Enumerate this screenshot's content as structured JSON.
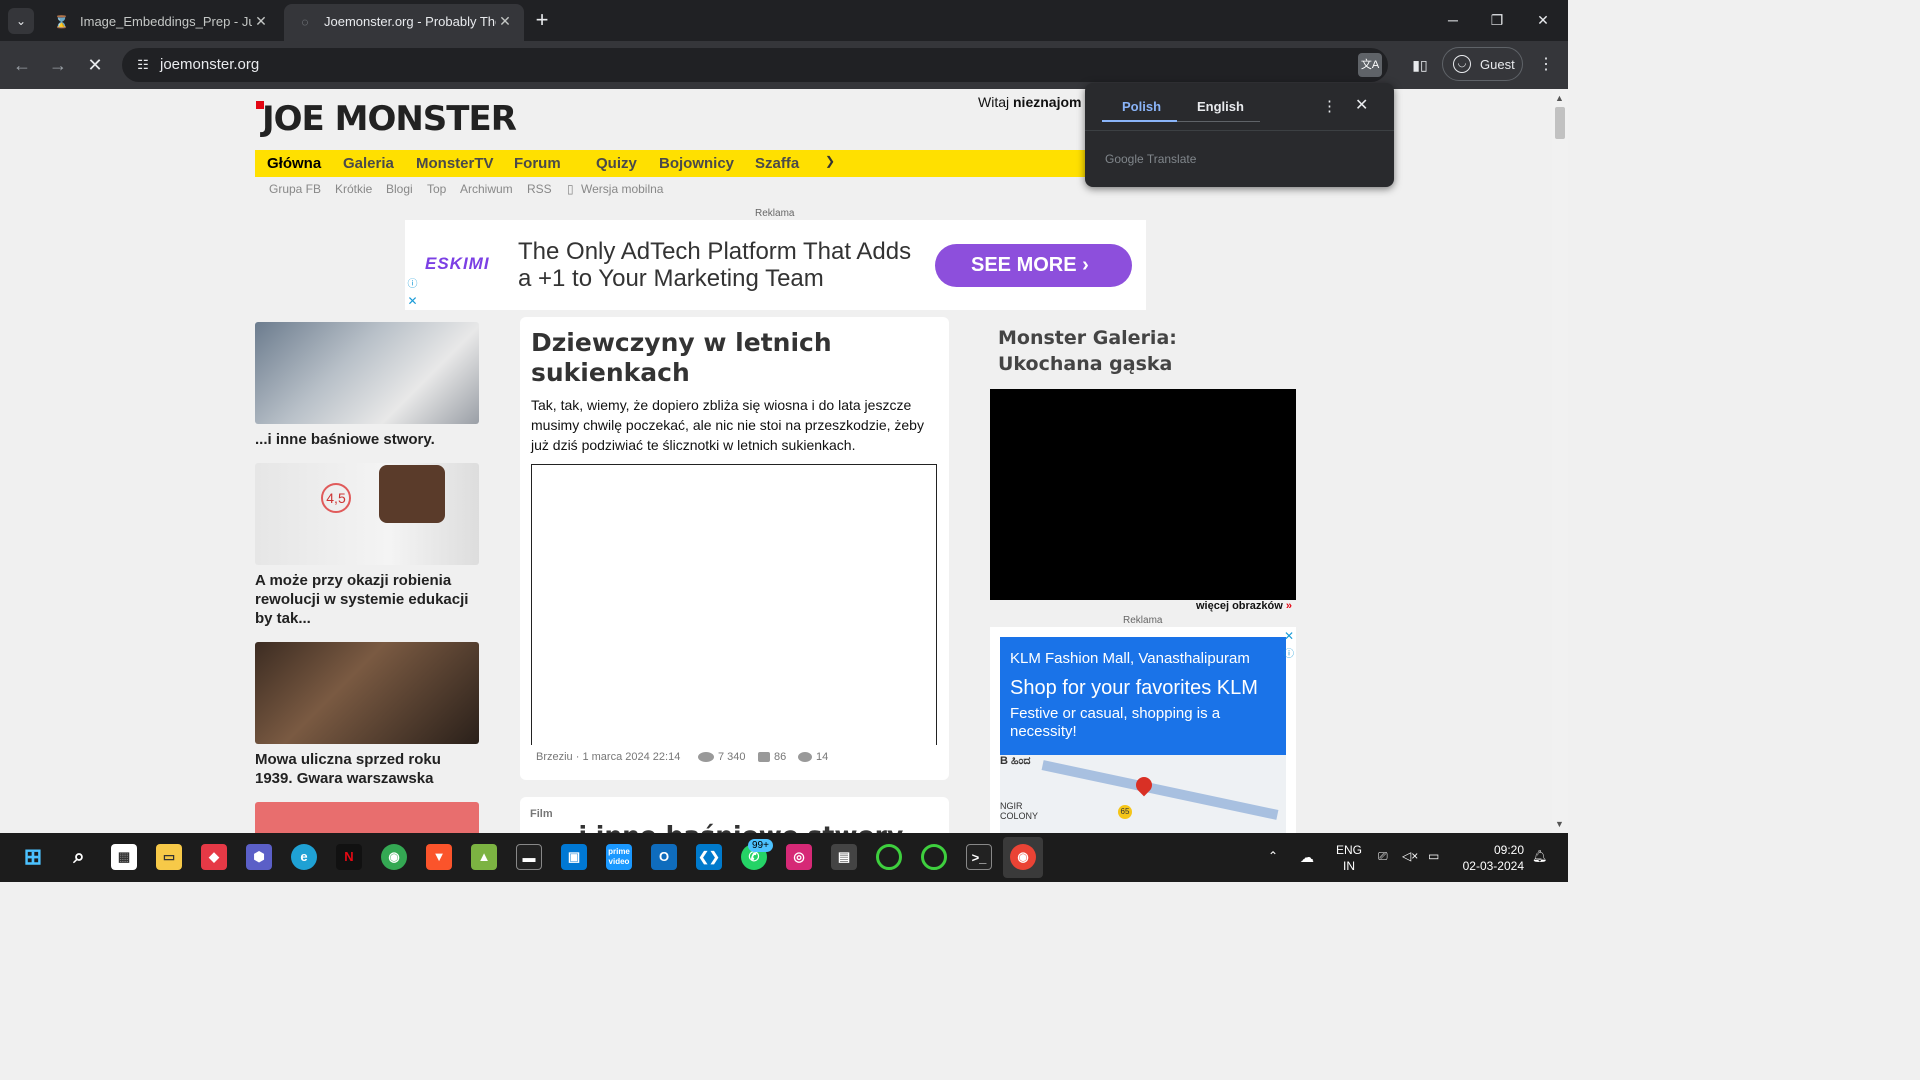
{
  "browser": {
    "tabs": [
      {
        "title": "Image_Embeddings_Prep - Jupy",
        "icon": "hourglass-icon"
      },
      {
        "title": "Joemonster.org - Probably The",
        "icon": "loading-icon"
      }
    ],
    "url": "joemonster.org",
    "profile_label": "Guest"
  },
  "translate_popup": {
    "source_lang": "Polish",
    "target_lang": "English",
    "provider": "Google Translate"
  },
  "site": {
    "logo": "JOE MONSTER",
    "welcome_prefix": "Witaj ",
    "welcome_user": "nieznajom",
    "main_nav": [
      "Główna",
      "Galeria",
      "MonsterTV",
      "Forum",
      "Quizy",
      "Bojownicy",
      "Szaffa"
    ],
    "sub_nav": [
      "Grupa FB",
      "Krótkie",
      "Blogi",
      "Top",
      "Archiwum",
      "RSS",
      "Wersja mobilna"
    ],
    "ad_label": "Reklama"
  },
  "top_ad": {
    "brand": "ESKIMI",
    "headline": "The Only AdTech Platform That Adds a +1 to Your Marketing Team",
    "cta": "SEE MORE"
  },
  "left_articles": [
    {
      "title": "...i inne baśniowe stwory."
    },
    {
      "title": "A może przy okazji robienia rewolucji w systemie edukacji by tak...",
      "thumb_text": "4,5"
    },
    {
      "title": "Mowa uliczna sprzed roku 1939. Gwara warszawska"
    }
  ],
  "main_article": {
    "title": "Dziewczyny w letnich sukienkach",
    "lead": "Tak, tak, wiemy, że dopiero zbliża się wiosna i do lata jeszcze musimy chwilę poczekać, ale nic nie stoi na przeszkodzie, żeby już dziś podziwiać te ślicznotki w letnich sukienkach.",
    "author": "Brzeziu",
    "date": "1 marca 2024 22:14",
    "views": "7 340",
    "likes": "86",
    "comments": "14"
  },
  "next_article": {
    "category": "Film",
    "title": "...i inne baśniowe stwory"
  },
  "gallery": {
    "title": "Monster Galeria: Ukochana gąska",
    "more": "więcej obrazków",
    "more_arrow": "»"
  },
  "side_ad": {
    "line1": "KLM Fashion Mall, Vanasthalipuram",
    "line2": "Shop for your favorites KLM",
    "line3": "Festive or casual, shopping is a necessity!",
    "map_labels": [
      "B ಹಿಂದ",
      "NGIR COLONY",
      "65"
    ]
  },
  "taskbar": {
    "whatsapp_badge": "99+",
    "lang_top": "ENG",
    "lang_bottom": "IN",
    "time": "09:20",
    "date": "02-03-2024"
  }
}
